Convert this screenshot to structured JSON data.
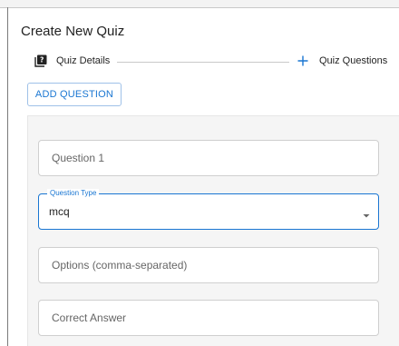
{
  "dialog": {
    "title": "Create New Quiz"
  },
  "stepper": {
    "steps": [
      {
        "label": "Quiz Details",
        "icon": "quiz-icon"
      },
      {
        "label": "Quiz Questions",
        "icon": "plus-icon"
      }
    ]
  },
  "actions": {
    "add_question_label": "ADD QUESTION"
  },
  "form": {
    "question_placeholder": "Question 1",
    "question_type_label": "Question Type",
    "question_type_value": "mcq",
    "options_placeholder": "Options (comma-separated)",
    "correct_answer_placeholder": "Correct Answer"
  },
  "colors": {
    "accent": "#1976d2",
    "panel_bg": "#f5f5f5"
  }
}
